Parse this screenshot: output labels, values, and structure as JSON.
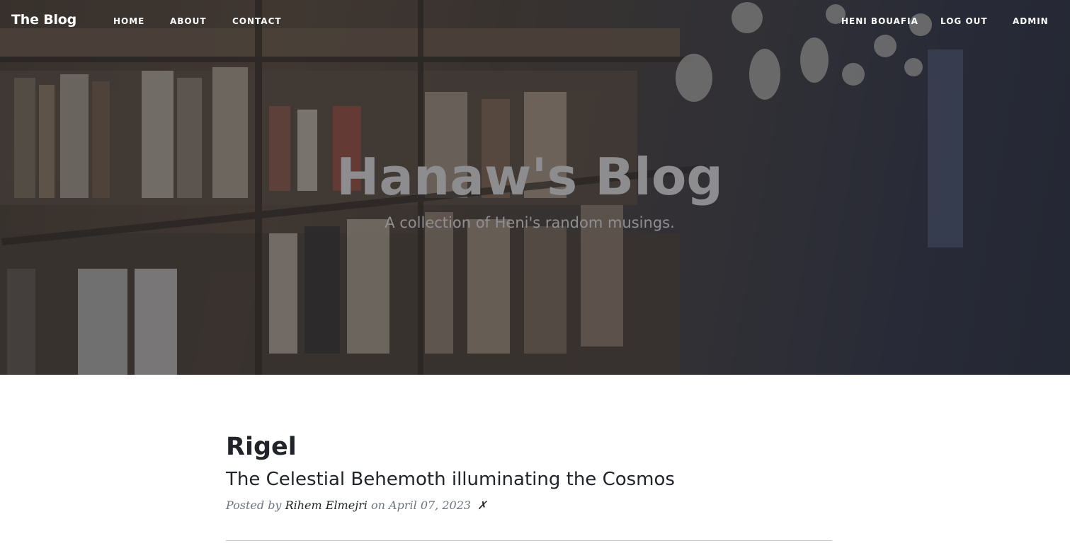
{
  "nav": {
    "brand": "The Blog",
    "left_links": [
      {
        "label": "HOME"
      },
      {
        "label": "ABOUT"
      },
      {
        "label": "CONTACT"
      }
    ],
    "right_links": [
      {
        "label": "HENI BOUAFIA"
      },
      {
        "label": "LOG OUT"
      },
      {
        "label": "ADMIN"
      }
    ]
  },
  "hero": {
    "title": "Hanaw's Blog",
    "subtitle": "A collection of Heni's random musings.",
    "background_image": "library-bookshelves-with-hanging-bulbs"
  },
  "posts": [
    {
      "title": "Rigel",
      "subtitle": "The Celestial Behemoth illuminating the Cosmos",
      "meta_prefix": "Posted by",
      "author": "Rihem Elmejri",
      "meta_on": "on",
      "date": "April 07, 2023",
      "delete_glyph": "✗"
    }
  ],
  "colors": {
    "hero_text": "#8d8d8f",
    "body_text": "#212529",
    "meta_text": "#6c757d",
    "nav_text": "#ffffff"
  }
}
